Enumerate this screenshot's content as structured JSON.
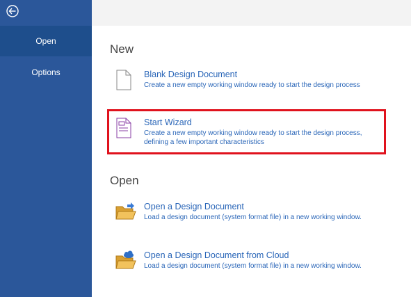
{
  "sidebar": {
    "back_icon": "back-arrow-circle-icon",
    "items": [
      {
        "label": "Open",
        "active": true
      },
      {
        "label": "Options",
        "active": false
      }
    ]
  },
  "new_section": {
    "heading": "New",
    "items": [
      {
        "title": "Blank Design Document",
        "description": "Create a new empty working window ready to start the design process",
        "icon": "blank-document-icon"
      },
      {
        "title": "Start Wizard",
        "description": "Create a new empty working window ready to start the design process, defining a few important characteristics",
        "icon": "wizard-document-icon"
      }
    ]
  },
  "open_section": {
    "heading": "Open",
    "items": [
      {
        "title": "Open a Design Document",
        "description": "Load a design document (system format file) in a new working window.",
        "icon": "open-folder-icon"
      },
      {
        "title": "Open a Design Document from Cloud",
        "description": "Load a design document (system format file) in a new working window.",
        "icon": "cloud-folder-icon"
      }
    ]
  },
  "colors": {
    "sidebar": "#2b579a",
    "sidebar_active": "#1e4e8c",
    "link": "#2a66b8",
    "highlight": "#e0121d"
  }
}
